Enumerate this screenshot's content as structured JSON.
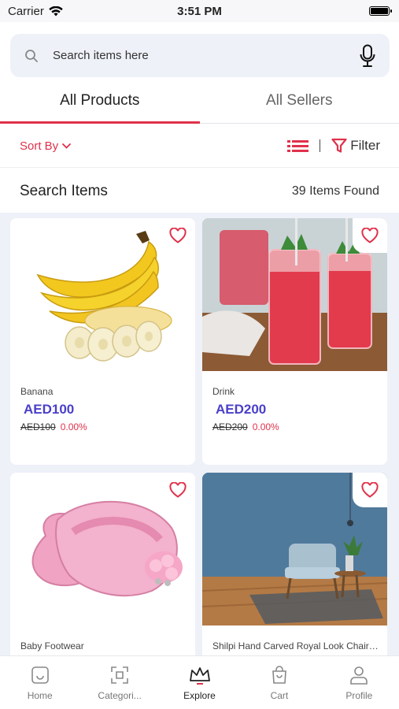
{
  "status": {
    "carrier": "Carrier",
    "time": "3:51 PM"
  },
  "search": {
    "placeholder": "Search items here"
  },
  "tabs": [
    {
      "label": "All Products",
      "active": true
    },
    {
      "label": "All Sellers",
      "active": false
    }
  ],
  "toolbar": {
    "sort_label": "Sort By",
    "filter_label": "Filter"
  },
  "results": {
    "title": "Search Items",
    "count": "39 Items Found"
  },
  "products": [
    {
      "name": "Banana",
      "price": "AED100",
      "old_price": "AED100",
      "discount": "0.00%"
    },
    {
      "name": "Drink",
      "price": "AED200",
      "old_price": "AED200",
      "discount": "0.00%"
    },
    {
      "name": "Baby Footwear",
      "price": "",
      "old_price": "",
      "discount": ""
    },
    {
      "name": "Shilpi Hand Carved Royal Look Chair ...",
      "price": "",
      "old_price": "",
      "discount": ""
    }
  ],
  "nav": [
    {
      "label": "Home",
      "icon": "home-icon"
    },
    {
      "label": "Categori...",
      "icon": "categories-icon"
    },
    {
      "label": "Explore",
      "icon": "crown-icon",
      "active": true
    },
    {
      "label": "Cart",
      "icon": "bag-icon"
    },
    {
      "label": "Profile",
      "icon": "profile-icon"
    }
  ],
  "colors": {
    "accent": "#e0314b",
    "price": "#4a3fc9",
    "background": "#eef1f8"
  }
}
